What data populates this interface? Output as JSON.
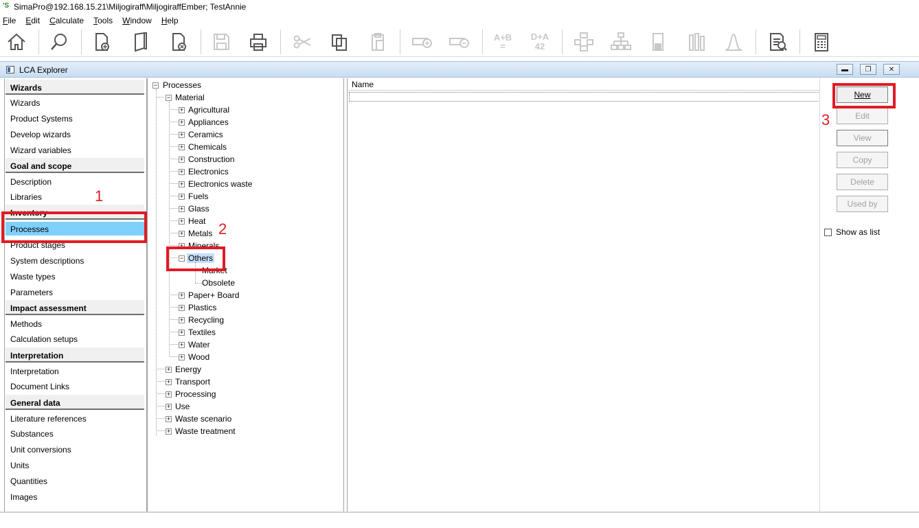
{
  "app": {
    "title": "SimaPro@192.168.15.21\\Miljogiraff\\MiljogiraffEmber; TestAnnie",
    "icon_text": "'S"
  },
  "menu": [
    "File",
    "Edit",
    "Calculate",
    "Tools",
    "Window",
    "Help"
  ],
  "toolbar": {
    "icons": [
      "home-icon",
      "search-icon",
      "new-document-icon",
      "open-book-icon",
      "close-document-icon",
      "save-icon",
      "print-icon",
      "cut-icon",
      "copy-icon",
      "paste-icon",
      "add-row-icon",
      "remove-row-icon",
      "a-plus-b-icon",
      "d-plus-a-icon",
      "network-icon",
      "tree-icon",
      "bar-chart-icon",
      "columns-chart-icon",
      "distribution-icon",
      "report-icon",
      "calculator-icon"
    ],
    "text_aplusb": [
      "A+B",
      "="
    ],
    "text_dplusa": [
      "D+A",
      "42"
    ]
  },
  "explorer": {
    "title": "LCA Explorer",
    "window_buttons": [
      "minimize",
      "restore",
      "close"
    ]
  },
  "left_nav": {
    "sections": [
      {
        "header": "Wizards",
        "items": [
          "Wizards",
          "Product Systems",
          "Develop wizards",
          "Wizard variables"
        ]
      },
      {
        "header": "Goal and scope",
        "items": [
          "Description",
          "Libraries"
        ]
      },
      {
        "header": "Inventory",
        "items": [
          "Processes",
          "Product stages",
          "System descriptions",
          "Waste types",
          "Parameters"
        ]
      },
      {
        "header": "Impact assessment",
        "items": [
          "Methods",
          "Calculation setups"
        ]
      },
      {
        "header": "Interpretation",
        "items": [
          "Interpretation",
          "Document Links"
        ]
      },
      {
        "header": "General data",
        "items": [
          "Literature references",
          "Substances",
          "Unit conversions",
          "Units",
          "Quantities",
          "Images"
        ]
      }
    ],
    "selected": "Processes"
  },
  "tree": {
    "root": "Processes",
    "material": "Material",
    "material_children": [
      "Agricultural",
      "Appliances",
      "Ceramics",
      "Chemicals",
      "Construction",
      "Electronics",
      "Electronics waste",
      "Fuels",
      "Glass",
      "Heat",
      "Metals",
      "Minerals",
      "Others",
      "Paper+ Board",
      "Plastics",
      "Recycling",
      "Textiles",
      "Water",
      "Wood"
    ],
    "others_children": [
      "Market",
      "Obsolete"
    ],
    "top_level": [
      "Energy",
      "Transport",
      "Processing",
      "Use",
      "Waste scenario",
      "Waste treatment"
    ],
    "selected": "Others"
  },
  "list": {
    "column_header": "Name"
  },
  "buttons": {
    "new": "New",
    "edit": "Edit",
    "view": "View",
    "copy": "Copy",
    "delete": "Delete",
    "used_by": "Used by"
  },
  "show_as_list": {
    "label": "Show as list",
    "checked": false
  },
  "annotations": [
    "1",
    "2",
    "3"
  ],
  "colors": {
    "selection": "#7fd0fb",
    "tree_selection": "#c5def7",
    "annotation_red": "#e01b24"
  }
}
